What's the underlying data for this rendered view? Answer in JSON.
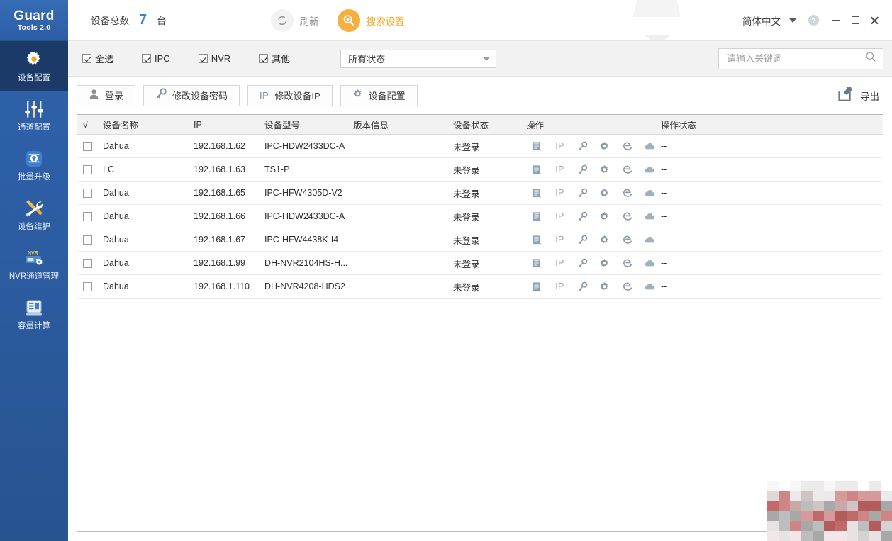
{
  "app": {
    "logo_title": "Guard",
    "logo_sub": "Tools 2.0"
  },
  "sidebar": {
    "items": [
      {
        "label": "设备配置",
        "icon": "gear-icon",
        "active": true
      },
      {
        "label": "通道配置",
        "icon": "sliders-icon",
        "active": false
      },
      {
        "label": "批量升级",
        "icon": "upload-icon",
        "active": false
      },
      {
        "label": "设备维护",
        "icon": "tools-icon",
        "active": false
      },
      {
        "label": "NVR通道管理",
        "icon": "nvr-icon",
        "active": false
      },
      {
        "label": "容量计算",
        "icon": "calculator-icon",
        "active": false
      }
    ]
  },
  "header": {
    "count_label": "设备总数",
    "count_value": "7",
    "count_unit": "台",
    "refresh_label": "刷新",
    "refresh_icon": "refresh-icon",
    "search_settings_label": "搜索设置",
    "search_settings_icon": "search-settings-icon",
    "language": "简体中文",
    "help_icon": "help-icon",
    "minimize_icon": "minimize-icon",
    "maximize_icon": "maximize-icon",
    "close_icon": "close-icon"
  },
  "filterbar": {
    "checkboxes": [
      {
        "label": "全选",
        "checked": true
      },
      {
        "label": "IPC",
        "checked": true
      },
      {
        "label": "NVR",
        "checked": true
      },
      {
        "label": "其他",
        "checked": true
      }
    ],
    "status_select": {
      "value": "所有状态",
      "options": [
        "所有状态"
      ]
    },
    "search": {
      "value": "",
      "placeholder": "请输入关键词",
      "icon": "search-icon"
    }
  },
  "toolbar": {
    "buttons": [
      {
        "label": "登录",
        "icon": "user-icon"
      },
      {
        "label": "修改设备密码",
        "icon": "key-icon"
      },
      {
        "label": "修改设备IP",
        "icon": "ip-text-icon"
      },
      {
        "label": "设备配置",
        "icon": "gear-icon"
      }
    ],
    "export_label": "导出",
    "export_icon": "export-icon"
  },
  "table": {
    "columns": [
      {
        "key": "check",
        "label": "√"
      },
      {
        "key": "name",
        "label": "设备名称"
      },
      {
        "key": "ip",
        "label": "IP"
      },
      {
        "key": "model",
        "label": "设备型号"
      },
      {
        "key": "version",
        "label": "版本信息"
      },
      {
        "key": "state",
        "label": "设备状态"
      },
      {
        "key": "ops",
        "label": "操作"
      },
      {
        "key": "opstate",
        "label": "操作状态"
      }
    ],
    "sort_column": "ip",
    "sort_direction": "asc",
    "row_action_icons": [
      "document-icon",
      "ip-text-icon",
      "key-icon",
      "gear-icon",
      "edge-browser-icon",
      "cloud-icon"
    ],
    "rows": [
      {
        "checked": false,
        "name": "Dahua",
        "ip": "192.168.1.62",
        "model": "IPC-HDW2433DC-A",
        "version": "",
        "state": "未登录",
        "opstate": "--"
      },
      {
        "checked": false,
        "name": "LC",
        "ip": "192.168.1.63",
        "model": "TS1-P",
        "version": "",
        "state": "未登录",
        "opstate": "--"
      },
      {
        "checked": false,
        "name": "Dahua",
        "ip": "192.168.1.65",
        "model": "IPC-HFW4305D-V2",
        "version": "",
        "state": "未登录",
        "opstate": "--"
      },
      {
        "checked": false,
        "name": "Dahua",
        "ip": "192.168.1.66",
        "model": "IPC-HDW2433DC-A",
        "version": "",
        "state": "未登录",
        "opstate": "--"
      },
      {
        "checked": false,
        "name": "Dahua",
        "ip": "192.168.1.67",
        "model": "IPC-HFW4438K-I4",
        "version": "",
        "state": "未登录",
        "opstate": "--"
      },
      {
        "checked": false,
        "name": "Dahua",
        "ip": "192.168.1.99",
        "model": "DH-NVR2104HS-H...",
        "version": "",
        "state": "未登录",
        "opstate": "--"
      },
      {
        "checked": false,
        "name": "Dahua",
        "ip": "192.168.1.110",
        "model": "DH-NVR4208-HDS2",
        "version": "",
        "state": "未登录",
        "opstate": "--"
      }
    ]
  },
  "colors": {
    "sidebar_blue": "#2d5ea5",
    "sidebar_active": "#1b3a68",
    "accent_count": "#3d7fd4",
    "accent_orange": "#f5b041",
    "filter_bg": "#f2f2f2"
  }
}
